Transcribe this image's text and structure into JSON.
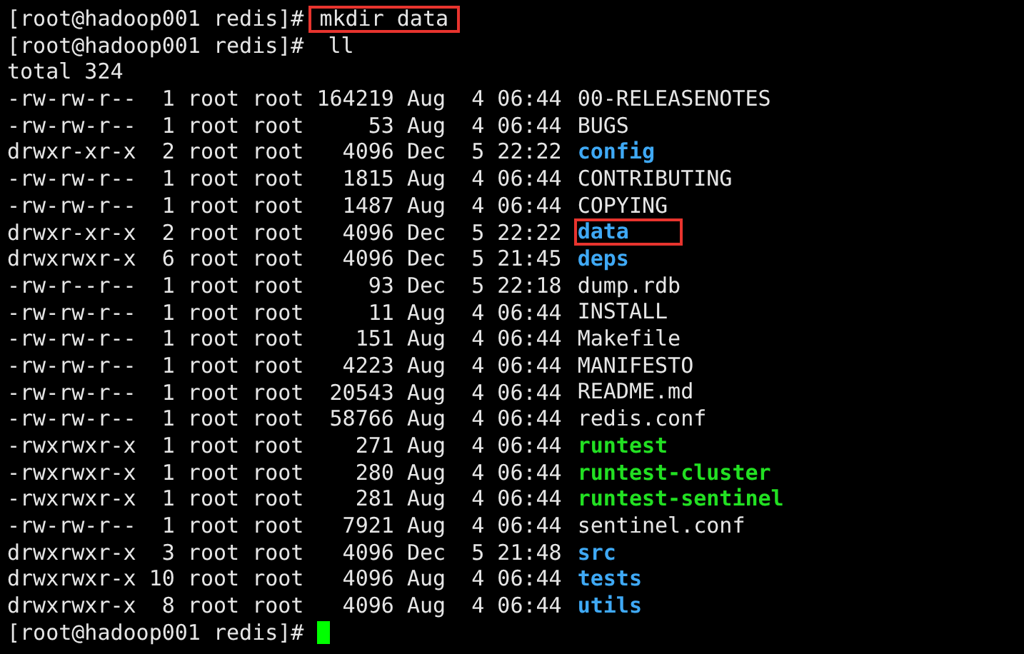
{
  "terminal": {
    "lines": [
      {
        "kind": "command",
        "prompt": "[root@hadoop001 redis]#",
        "command": "mkdir data",
        "highlighted": true
      },
      {
        "kind": "command",
        "prompt": "[root@hadoop001 redis]#",
        "command": "ll",
        "highlighted": false
      },
      {
        "kind": "output",
        "text": "total 324"
      },
      {
        "kind": "file",
        "meta": "-rw-rw-r--  1 root root 164219 Aug  4 06:44",
        "name": "00-RELEASENOTES",
        "highlighted": false
      },
      {
        "kind": "file",
        "meta": "-rw-rw-r--  1 root root     53 Aug  4 06:44",
        "name": "BUGS",
        "highlighted": false
      },
      {
        "kind": "dir",
        "meta": "drwxr-xr-x  2 root root   4096 Dec  5 22:22",
        "name": "config",
        "highlighted": false
      },
      {
        "kind": "file",
        "meta": "-rw-rw-r--  1 root root   1815 Aug  4 06:44",
        "name": "CONTRIBUTING",
        "highlighted": false
      },
      {
        "kind": "file",
        "meta": "-rw-rw-r--  1 root root   1487 Aug  4 06:44",
        "name": "COPYING",
        "highlighted": false
      },
      {
        "kind": "dir",
        "meta": "drwxr-xr-x  2 root root   4096 Dec  5 22:22",
        "name": "data",
        "highlighted": true
      },
      {
        "kind": "dir",
        "meta": "drwxrwxr-x  6 root root   4096 Dec  5 21:45",
        "name": "deps",
        "highlighted": false
      },
      {
        "kind": "file",
        "meta": "-rw-r--r--  1 root root     93 Dec  5 22:18",
        "name": "dump.rdb",
        "highlighted": false
      },
      {
        "kind": "file",
        "meta": "-rw-rw-r--  1 root root     11 Aug  4 06:44",
        "name": "INSTALL",
        "highlighted": false
      },
      {
        "kind": "file",
        "meta": "-rw-rw-r--  1 root root    151 Aug  4 06:44",
        "name": "Makefile",
        "highlighted": false
      },
      {
        "kind": "file",
        "meta": "-rw-rw-r--  1 root root   4223 Aug  4 06:44",
        "name": "MANIFESTO",
        "highlighted": false
      },
      {
        "kind": "file",
        "meta": "-rw-rw-r--  1 root root  20543 Aug  4 06:44",
        "name": "README.md",
        "highlighted": false
      },
      {
        "kind": "file",
        "meta": "-rw-rw-r--  1 root root  58766 Aug  4 06:44",
        "name": "redis.conf",
        "highlighted": false
      },
      {
        "kind": "exec",
        "meta": "-rwxrwxr-x  1 root root    271 Aug  4 06:44",
        "name": "runtest",
        "highlighted": false
      },
      {
        "kind": "exec",
        "meta": "-rwxrwxr-x  1 root root    280 Aug  4 06:44",
        "name": "runtest-cluster",
        "highlighted": false
      },
      {
        "kind": "exec",
        "meta": "-rwxrwxr-x  1 root root    281 Aug  4 06:44",
        "name": "runtest-sentinel",
        "highlighted": false
      },
      {
        "kind": "file",
        "meta": "-rw-rw-r--  1 root root   7921 Aug  4 06:44",
        "name": "sentinel.conf",
        "highlighted": false
      },
      {
        "kind": "dir",
        "meta": "drwxrwxr-x  3 root root   4096 Dec  5 21:48",
        "name": "src",
        "highlighted": false
      },
      {
        "kind": "dir",
        "meta": "drwxrwxr-x 10 root root   4096 Aug  4 06:44",
        "name": "tests",
        "highlighted": false
      },
      {
        "kind": "dir",
        "meta": "drwxrwxr-x  8 root root   4096 Aug  4 06:44",
        "name": "utils",
        "highlighted": false
      },
      {
        "kind": "prompt",
        "prompt": "[root@hadoop001 redis]#",
        "cursor": true
      }
    ]
  }
}
